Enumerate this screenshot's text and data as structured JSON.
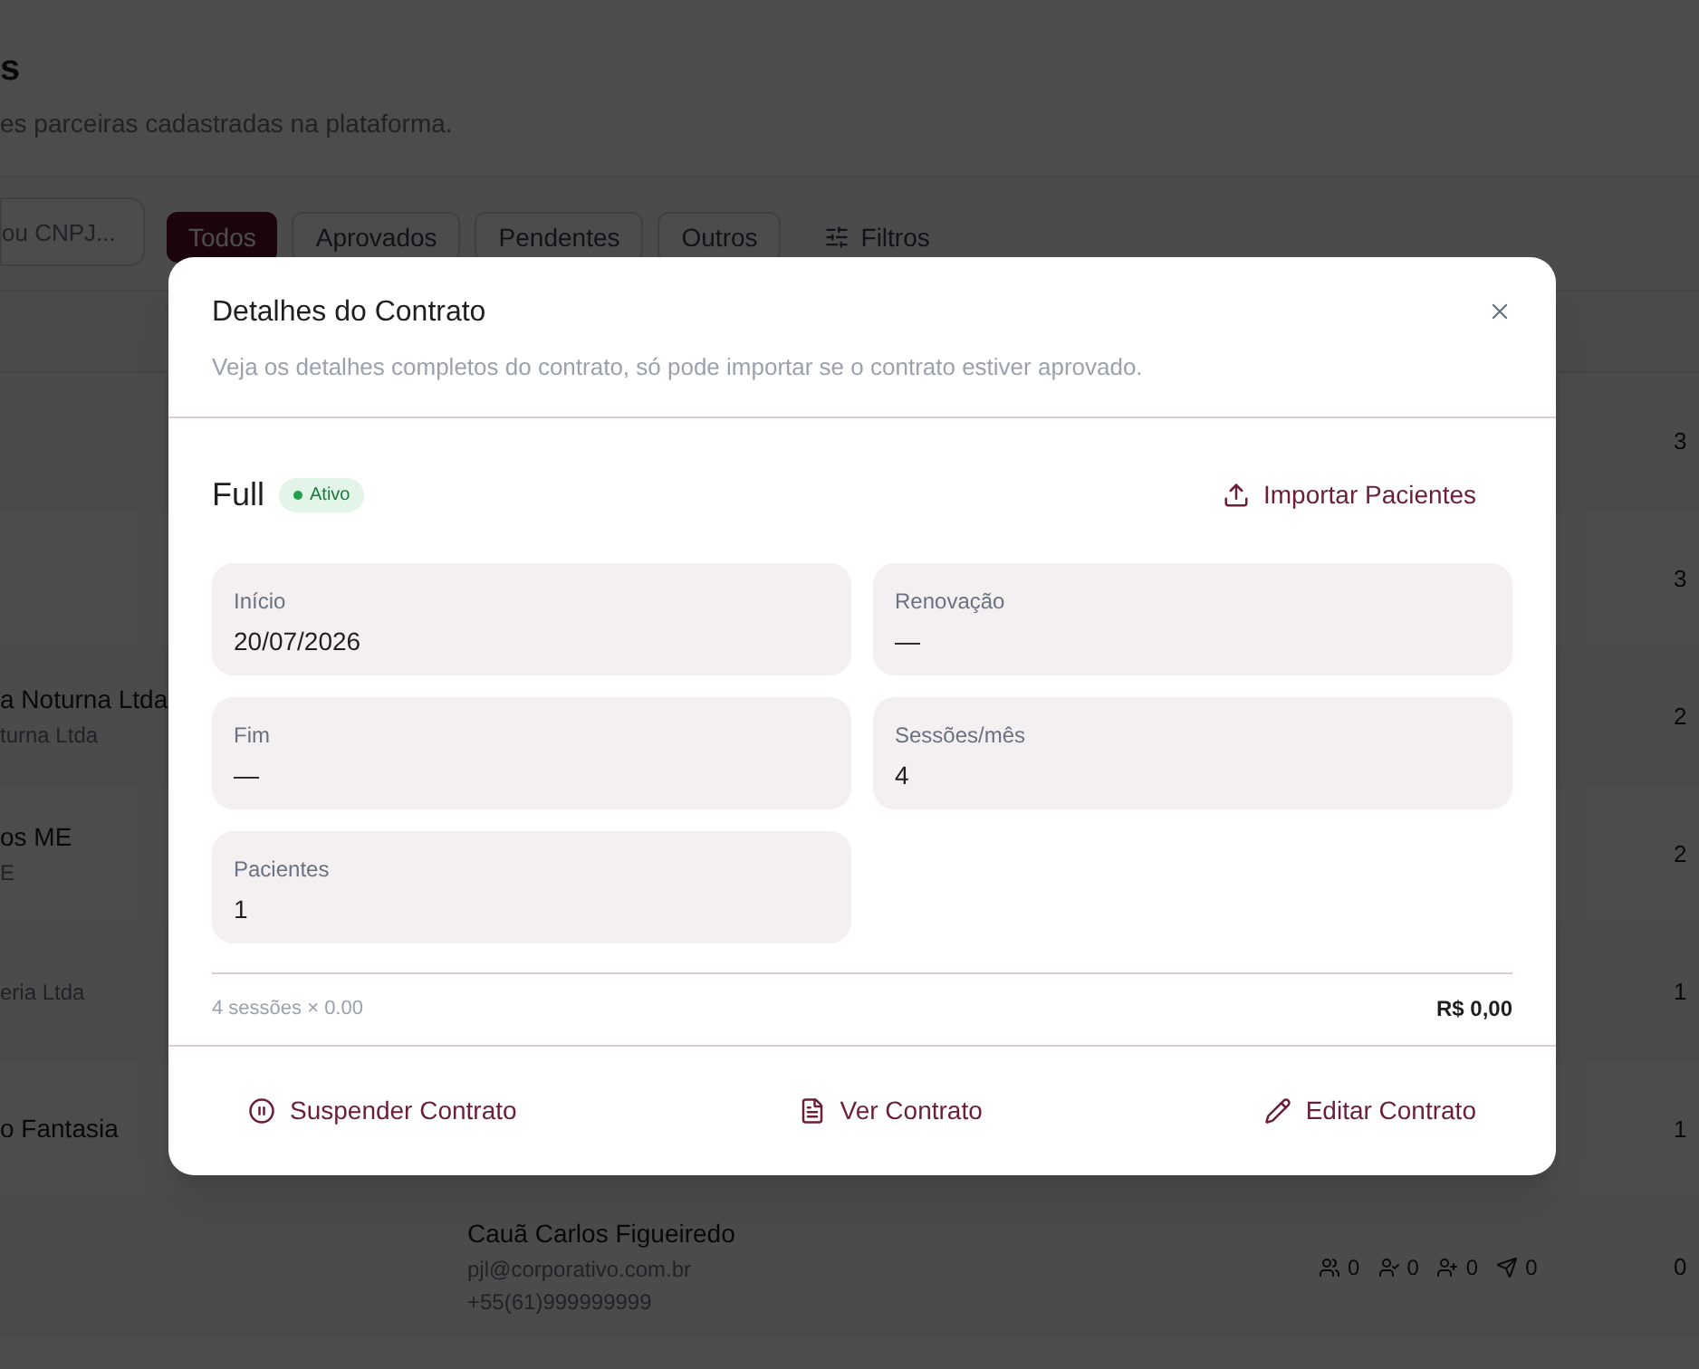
{
  "page": {
    "title": "s",
    "subtitle": "es parceiras cadastradas na plataforma."
  },
  "toolbar": {
    "search": {
      "placeholder": "ou CNPJ..."
    },
    "filters": [
      {
        "label": "Todos",
        "selected": true
      },
      {
        "label": "Aprovados",
        "selected": false
      },
      {
        "label": "Pendentes",
        "selected": false
      },
      {
        "label": "Outros",
        "selected": false
      }
    ],
    "filters_button": "Filtros"
  },
  "table": {
    "rows": [
      {
        "count": "3"
      },
      {
        "count": "3"
      },
      {
        "name": "a Noturna Ltda",
        "subtitle": "turna Ltda",
        "count": "2"
      },
      {
        "name": "os ME",
        "subtitle": "E",
        "count": "2"
      },
      {
        "subtitle": "eria Ltda",
        "count": "1"
      },
      {
        "name": "o Fantasia",
        "count": "1"
      },
      {
        "contact": {
          "name": "Cauã Carlos Figueiredo",
          "email": "pjl@corporativo.com.br",
          "phone": "+55(61)999999999"
        },
        "stats": [
          {
            "kind": "users",
            "value": "0"
          },
          {
            "kind": "user-check",
            "value": "0"
          },
          {
            "kind": "user-plus",
            "value": "0"
          },
          {
            "kind": "send",
            "value": "0"
          }
        ],
        "count": "0"
      }
    ]
  },
  "modal": {
    "title": "Detalhes do Contrato",
    "description": "Veja os detalhes completos do contrato, só pode importar se o contrato estiver aprovado.",
    "plan": {
      "name": "Full",
      "status": {
        "label": "Ativo",
        "active": true
      }
    },
    "import_button": "Importar Pacientes",
    "fields": [
      {
        "label": "Início",
        "value": "20/07/2026"
      },
      {
        "label": "Renovação",
        "value": "—"
      },
      {
        "label": "Fim",
        "value": "—"
      },
      {
        "label": "Sessões/mês",
        "value": "4"
      },
      {
        "label": "Pacientes",
        "value": "1"
      }
    ],
    "summary": {
      "formula": "4 sessões × 0.00",
      "total": "R$ 0,00"
    },
    "actions": [
      {
        "kind": "suspend",
        "label": "Suspender Contrato"
      },
      {
        "kind": "view",
        "label": "Ver Contrato"
      },
      {
        "kind": "edit",
        "label": "Editar Contrato"
      }
    ]
  }
}
